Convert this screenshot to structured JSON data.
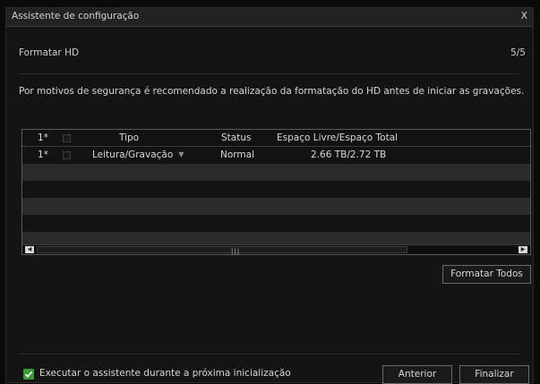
{
  "window": {
    "title": "Assistente de configuração",
    "close_label": "X"
  },
  "step": {
    "label": "Formatar HD",
    "counter": "5/5"
  },
  "description": "Por motivos de segurança é recomendado a realização da formatação do HD antes de iniciar as gravações.",
  "table": {
    "headers": {
      "index": "1*",
      "type": "Tipo",
      "status": "Status",
      "space": "Espaço Livre/Espaço Total"
    },
    "rows": [
      {
        "index": "1*",
        "type": "Leitura/Gravação",
        "status": "Normal",
        "space": "2.66 TB/2.72 TB",
        "checked": false
      }
    ],
    "empty_row_count": 5
  },
  "buttons": {
    "format_all": "Formatar Todos",
    "previous": "Anterior",
    "finish": "Finalizar"
  },
  "footer": {
    "run_wizard_label": "Executar o assistente durante a próxima inicialização",
    "run_wizard_checked": true
  },
  "colors": {
    "check_green": "#3c9a3a",
    "row_alt": "#2a2a2a",
    "background": "#141414"
  }
}
